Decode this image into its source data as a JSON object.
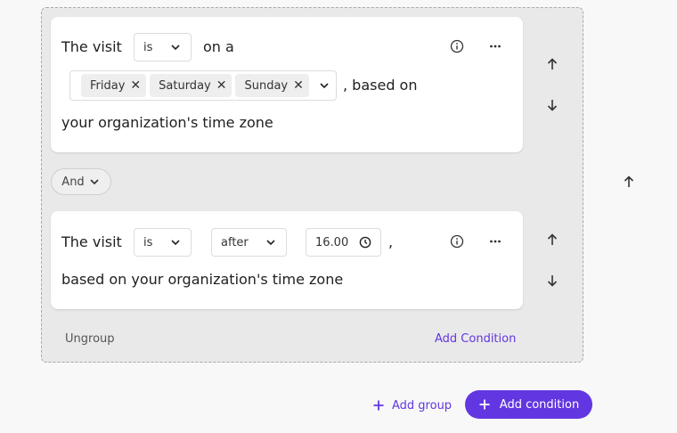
{
  "group": {
    "ungroup_label": "Ungroup",
    "add_condition_link": "Add Condition"
  },
  "condition1": {
    "prefix": "The visit",
    "operator": "is",
    "middle": "on a",
    "days": [
      "Friday",
      "Saturday",
      "Sunday"
    ],
    "suffix": ", based on",
    "line3": "your organization's time zone"
  },
  "connector": {
    "label": "And"
  },
  "condition2": {
    "prefix": "The visit",
    "operator": "is",
    "comparison": "after",
    "time_value": "16.00",
    "comma": ",",
    "line2": "based on your organization's time zone"
  },
  "footer": {
    "add_group_label": "Add group",
    "add_condition_label": "Add condition"
  },
  "colors": {
    "accent": "#6236e0",
    "group_bg": "#e9e9e9",
    "card_bg": "#ffffff"
  },
  "icons": [
    "info-icon",
    "more-horizontal-icon",
    "arrow-up-icon",
    "arrow-down-icon",
    "chevron-down-icon",
    "clock-icon",
    "close-icon",
    "plus-icon"
  ]
}
